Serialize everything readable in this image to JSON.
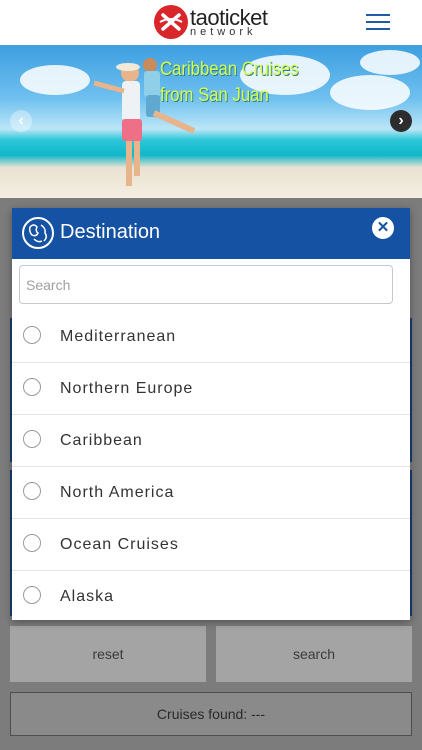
{
  "header": {
    "logo_main": "taoticket",
    "logo_sub": "network"
  },
  "banner": {
    "title_line1": "Caribbean Cruises",
    "title_line2": "from San Juan",
    "prev_icon": "chevron-left-icon",
    "next_icon": "chevron-right-icon"
  },
  "modal": {
    "title": "Destination",
    "icon": "globe-icon",
    "close_icon": "close-icon",
    "search_placeholder": "Search",
    "options": [
      {
        "label": "Mediterranean"
      },
      {
        "label": "Northern Europe"
      },
      {
        "label": "Caribbean"
      },
      {
        "label": "North America"
      },
      {
        "label": "Ocean Cruises"
      },
      {
        "label": "Alaska"
      }
    ]
  },
  "actions": {
    "reset_label": "reset",
    "search_label": "search"
  },
  "results": {
    "found_text": "Cruises found: ---"
  },
  "colors": {
    "primary_blue": "#1652a3",
    "logo_red": "#d8262b",
    "overlay_gray": "#7c7c7c"
  }
}
